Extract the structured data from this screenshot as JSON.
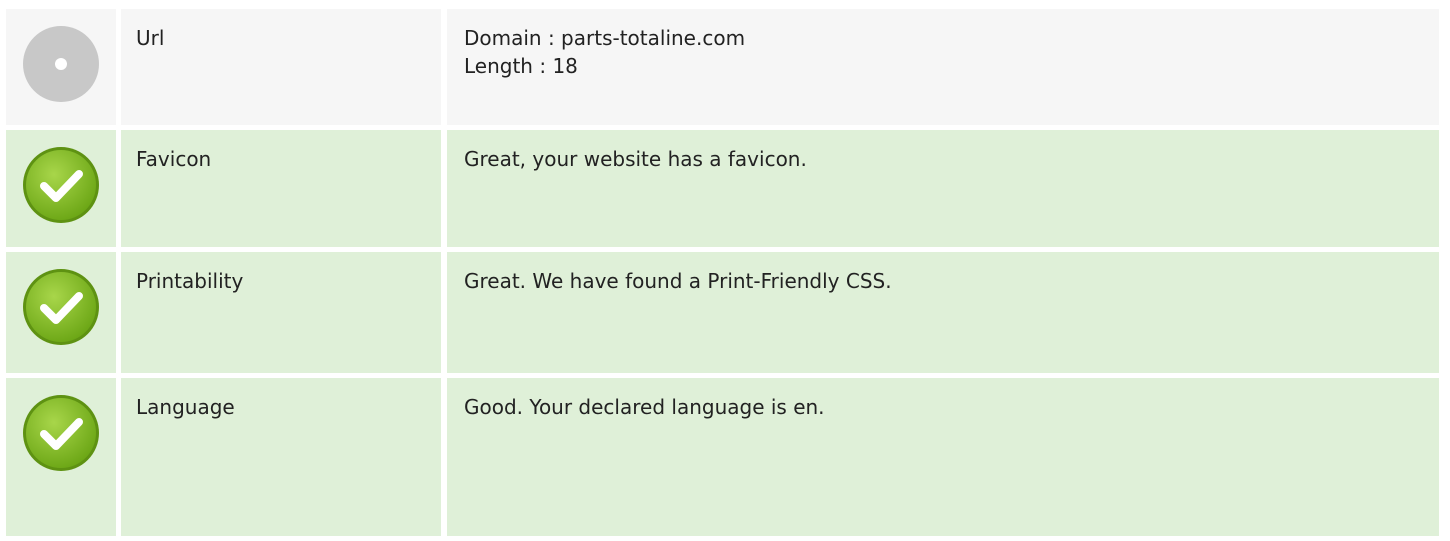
{
  "rows": [
    {
      "status": "neutral",
      "icon": "neutral-circle-icon",
      "name": "Url",
      "values": [
        "Domain : parts-totaline.com",
        "Length : 18"
      ]
    },
    {
      "status": "good",
      "icon": "check-circle-icon",
      "name": "Favicon",
      "values": [
        "Great, your website has a favicon."
      ]
    },
    {
      "status": "good",
      "icon": "check-circle-icon",
      "name": "Printability",
      "values": [
        "Great. We have found a Print-Friendly CSS."
      ]
    },
    {
      "status": "good",
      "icon": "check-circle-icon",
      "name": "Language",
      "values": [
        "Good. Your declared language is en."
      ]
    }
  ],
  "colors": {
    "neutral_bg": "#f6f6f6",
    "good_bg": "#dff0d8",
    "check_green": "#7cb518",
    "neutral_gray": "#c8c8c8"
  }
}
